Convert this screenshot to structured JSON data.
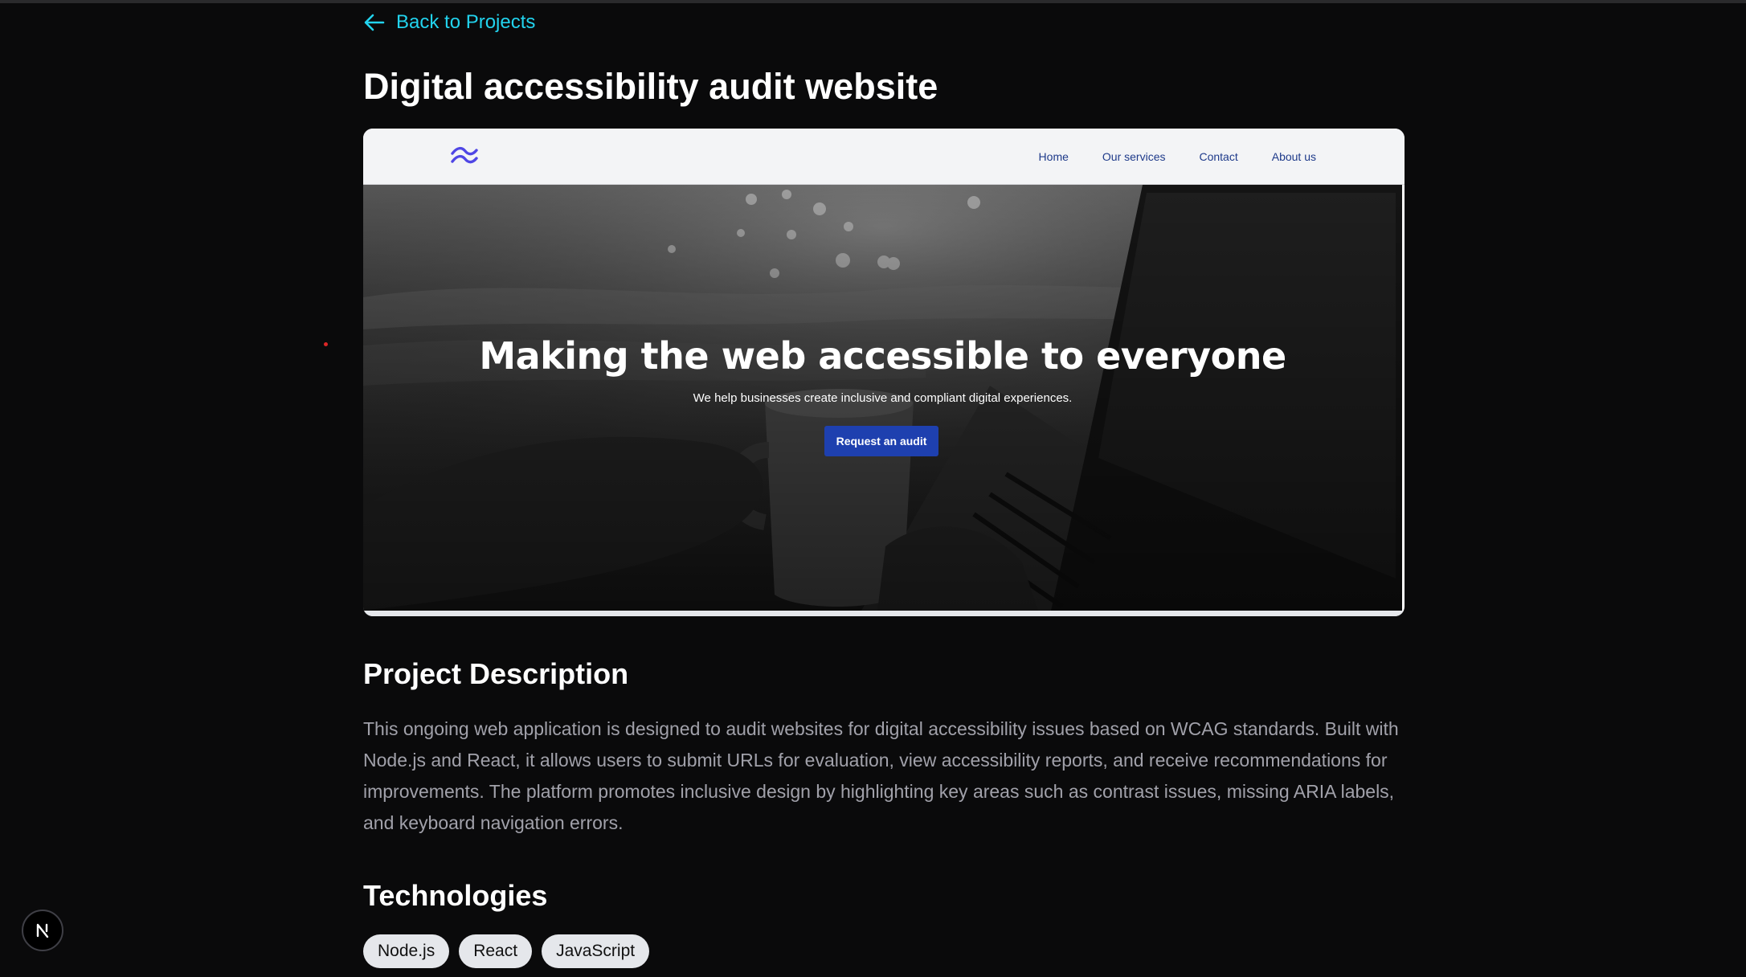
{
  "back_link": {
    "label": "Back to Projects",
    "icon": "arrow-left-icon"
  },
  "page_title": "Digital accessibility audit website",
  "preview": {
    "logo_icon": "tailwind-wave-logo",
    "nav": [
      "Home",
      "Our services",
      "Contact",
      "About us"
    ],
    "hero": {
      "title": "Making the web accessible to everyone",
      "subtitle": "We help businesses create inclusive and compliant digital experiences.",
      "cta": "Request an audit"
    }
  },
  "description": {
    "heading": "Project Description",
    "text": "This ongoing web application is designed to audit websites for digital accessibility issues based on WCAG standards. Built with Node.js and React, it allows users to submit URLs for evaluation, view accessibility reports, and receive recommendations for improvements. The platform promotes inclusive design by highlighting key areas such as contrast issues, missing ARIA labels, and keyboard navigation errors."
  },
  "technologies": {
    "heading": "Technologies",
    "tags": [
      "Node.js",
      "React",
      "JavaScript"
    ]
  },
  "next_badge": {
    "label": "N",
    "icon": "nextjs-logo"
  },
  "colors": {
    "background": "#0a0a0b",
    "accent_link": "#22d3ee",
    "cta_button": "#1e40af",
    "nav_link": "#1e3a8a",
    "body_text": "#a1a1aa",
    "tag_bg": "#e5e7eb"
  }
}
